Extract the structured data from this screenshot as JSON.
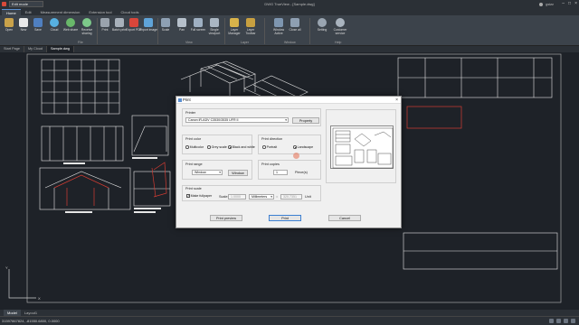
{
  "titlebar": {
    "quick_access": "Edit mode",
    "title": "DWG TrueView - [Sample.dwg]",
    "user": "gstar",
    "controls": [
      "–",
      "□",
      "×"
    ]
  },
  "ribbon_tabs": [
    "Home",
    "Edit",
    "Measurement dimension",
    "Extension tool",
    "Cloud tools"
  ],
  "ribbon": {
    "file_buttons": [
      "Open",
      "New",
      "Save",
      "Cloud",
      "Web share",
      "Receive sharing"
    ],
    "print_buttons": [
      "Print",
      "Batch print",
      "Export PDF",
      "Export image"
    ],
    "view_buttons": [
      "Scale",
      "Pan",
      "Full screen",
      "Single viewport"
    ],
    "layer_buttons": [
      "Layer Manager",
      "Layer Toolbar"
    ],
    "window_buttons": [
      "Window Active",
      "Close all"
    ],
    "help_buttons": [
      "Setting",
      "Customer service"
    ],
    "groups": [
      "File",
      "View",
      "Layer",
      "Window",
      "Help"
    ]
  },
  "doc_tabs": [
    "Start Page",
    "My Cloud",
    "Sample.dwg"
  ],
  "layout_tabs": [
    "Model",
    "Layout1"
  ],
  "status": {
    "coords": "31597867824, -81550.6800, 0.0000"
  },
  "dialog": {
    "title": "Print",
    "close": "×",
    "printer": {
      "label": "Printer",
      "value": "Canon iR-ADV C3530/3535 UFR II",
      "properties_label": "Property"
    },
    "print_color": {
      "label": "Print color",
      "options": [
        "Multicolor",
        "Grey scale",
        "Black and white"
      ],
      "selected": 2
    },
    "print_direction": {
      "label": "Print direction",
      "options": [
        "Portrait",
        "Landscape"
      ],
      "selected": 1
    },
    "print_range": {
      "label": "Print range",
      "value": "Window",
      "window_button": "Window"
    },
    "print_copies": {
      "label": "Print copies",
      "value": "1",
      "unit": "Piece(s)"
    },
    "print_scale": {
      "label": "Print scale",
      "make_fullpaper": "Make fullpaper",
      "make_fullpaper_checked": true,
      "scale_label": "Scale:",
      "scale_value1": "1.0000",
      "units": "Millimeters",
      "eq": "=",
      "scale_value2": "320.7351",
      "unit2": "Unit"
    },
    "buttons": {
      "preview": "Print preview",
      "print": "Print",
      "cancel": "Cancel"
    }
  },
  "colors": {
    "canvas": "#1e2228",
    "drawing_white": "#e6e6e6",
    "drawing_red": "#d33c32",
    "accent": "#3c7fd1"
  }
}
